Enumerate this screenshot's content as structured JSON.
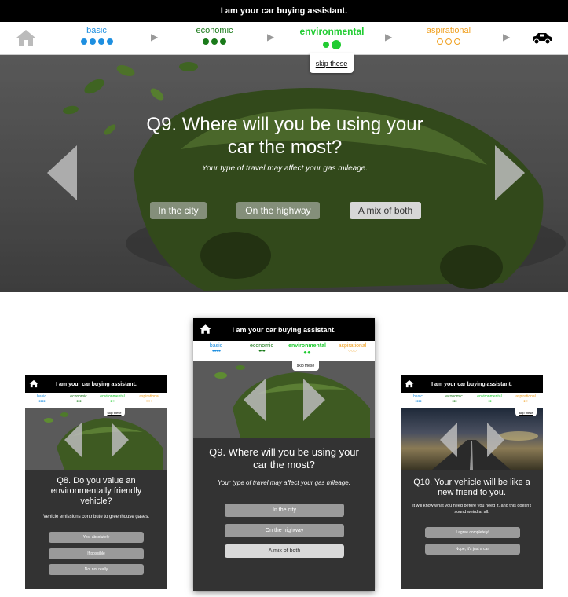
{
  "app_title": "I am your car buying assistant.",
  "colors": {
    "basic": "#1e8fe0",
    "economic": "#1a7a1a",
    "environmental": "#22cc33",
    "aspirational": "#f0a020"
  },
  "nav": {
    "home_icon": "home-icon",
    "steps": [
      {
        "label": "basic",
        "dots": "filled-4"
      },
      {
        "label": "economic",
        "dots": "filled-3"
      },
      {
        "label": "environmental",
        "dots": "filled-2"
      },
      {
        "label": "aspirational",
        "dots": "empty-3"
      }
    ],
    "car_icon": "car-icon",
    "skip_label": "skip these"
  },
  "desktop": {
    "question": "Q9. Where will you be using your car the most?",
    "hint": "Your type of travel may affect your gas mileage.",
    "options": [
      "In the city",
      "On the highway",
      "A mix of both"
    ],
    "selected_index": 2
  },
  "phone_left": {
    "question": "Q8. Do you value an environmentally friendly vehicle?",
    "hint": "Vehicle emissions contribute to greenhouse gases.",
    "options": [
      "Yes, absolutely",
      "If possible",
      "No, not really"
    ]
  },
  "phone_center": {
    "question": "Q9. Where will you be using your car the most?",
    "hint": "Your type of travel may affect your gas mileage.",
    "options": [
      "In the city",
      "On the highway",
      "A mix of both"
    ],
    "selected_index": 2
  },
  "phone_right": {
    "question": "Q10. Your vehicle will be like a new friend to you.",
    "hint": "It will know what you need before you need it, and this doesn't sound weird at all.",
    "options": [
      "I agree completely!",
      "Nope, it's just a car."
    ]
  }
}
